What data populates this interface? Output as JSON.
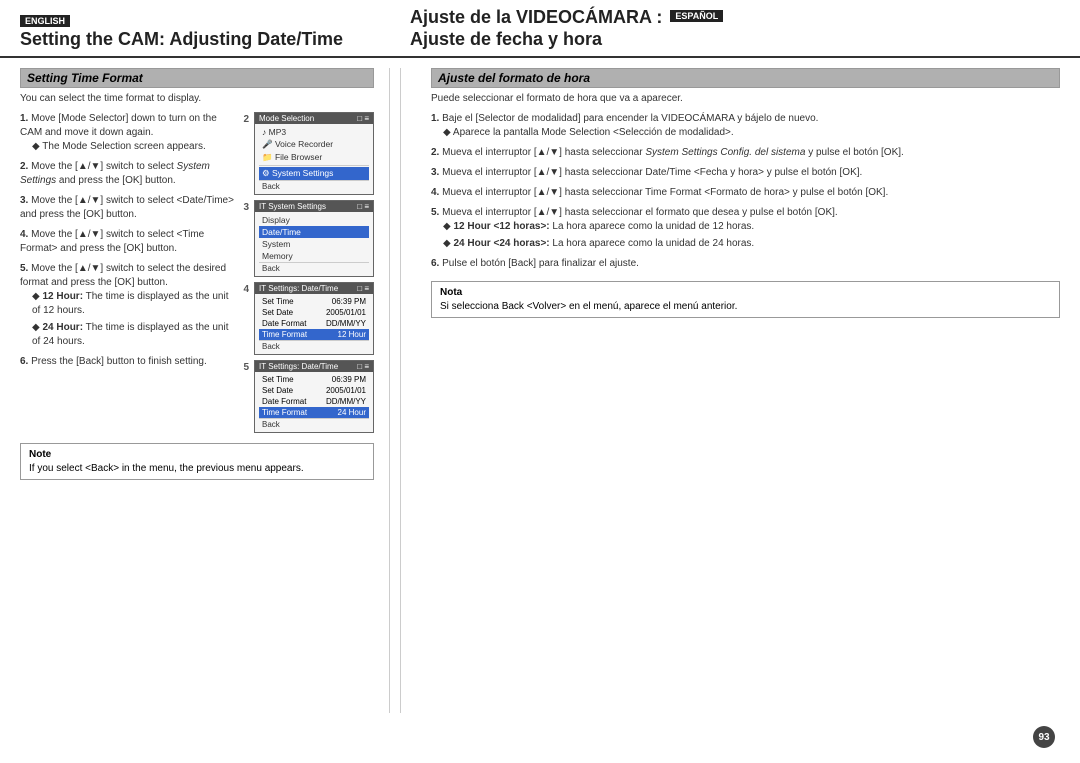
{
  "header": {
    "english_badge": "ENGLISH",
    "espanol_badge": "ESPAÑOL",
    "title_left_line1": "Setting the CAM: Adjusting Date/Time",
    "title_right_line1": "Ajuste de la VIDEOCÁMARA :",
    "title_right_line2": "Ajuste de fecha y hora"
  },
  "left": {
    "section_header": "Setting Time Format",
    "intro": "You can select the time format to display.",
    "steps": [
      {
        "num": "1.",
        "text": "Move [Mode Selector] down to turn on the CAM and move it down again.",
        "bullet": "The Mode Selection screen appears."
      },
      {
        "num": "2.",
        "text_bold": "Move the [▲/▼] switch to select ",
        "text_italic": "System Settings",
        "text_end": " and press the [OK] button."
      },
      {
        "num": "3.",
        "text": "Move the [▲/▼] switch to select <Date/Time> and press the [OK] button."
      },
      {
        "num": "4.",
        "text": "Move the [▲/▼] switch to select <Time Format> and press the [OK] button."
      },
      {
        "num": "5.",
        "text": "Move the [▲/▼] switch to select the desired format and press the [OK] button.",
        "bullets": [
          "12 Hour: The time is displayed as the unit of 12 hours.",
          "24 Hour: The time is displayed as the unit of 24 hours."
        ]
      },
      {
        "num": "6.",
        "text": "Press the [Back] button to finish setting."
      }
    ],
    "note": {
      "title": "Note",
      "text": "If you select <Back> in the menu, the previous menu appears."
    }
  },
  "right": {
    "section_header": "Ajuste del formato de hora",
    "intro": "Puede seleccionar el formato de hora que va a aparecer.",
    "steps": [
      {
        "num": "1.",
        "text": "Baje el [Selector de modalidad] para encender la VIDEOCÁMARA y bájelo de nuevo.",
        "bullet": "Aparece la pantalla Mode Selection <Selección de modalidad>."
      },
      {
        "num": "2.",
        "text": "Mueva el interruptor [▲/▼] hasta seleccionar ",
        "text_italic": "System Settings  Config. del sistema",
        "text_end": " y pulse el botón [OK]."
      },
      {
        "num": "3.",
        "text": "Mueva el interruptor [▲/▼] hasta seleccionar Date/Time <Fecha y hora> y pulse el botón [OK]."
      },
      {
        "num": "4.",
        "text": "Mueva el interruptor [▲/▼] hasta seleccionar Time Format <Formato de hora> y pulse el botón [OK]."
      },
      {
        "num": "5.",
        "text": "Mueva el interruptor [▲/▼] hasta seleccionar el formato que desea y pulse el botón [OK].",
        "bullets": [
          "12 Hour <12 horas>: La hora aparece como la unidad de 12 horas.",
          "24 Hour <24 horas>: La hora aparece como la unidad de 24 horas."
        ]
      },
      {
        "num": "6.",
        "text": "Pulse el botón [Back] para finalizar el ajuste."
      }
    ],
    "note": {
      "title": "Nota",
      "text": "Si selecciona Back <Volver> en el menú, aparece el menú anterior."
    }
  },
  "panels": {
    "panel2": {
      "header": "Mode Selection",
      "items": [
        "MP3",
        "Voice Recorder",
        "File Browser",
        "System Settings"
      ],
      "selected": "System Settings",
      "back": "Back"
    },
    "panel3": {
      "header": "IT System Settings",
      "items": [
        "Display",
        "Date/Time",
        "System",
        "Memory"
      ],
      "selected": "Date/Time",
      "back": "Back"
    },
    "panel4": {
      "header": "IT Settings: Date/Time",
      "rows": [
        {
          "label": "Set Time",
          "value": "06:39 PM"
        },
        {
          "label": "Set Date",
          "value": "2005/01/01"
        },
        {
          "label": "Date Format",
          "value": "DD/MM/YY"
        },
        {
          "label": "Time Format",
          "value": "12 Hour"
        }
      ],
      "selected": "Time Format",
      "back": "Back"
    },
    "panel5": {
      "header": "IT Settings: Date/Time",
      "rows": [
        {
          "label": "Set Time",
          "value": "06:39 PM"
        },
        {
          "label": "Set Date",
          "value": "2005/01/01"
        },
        {
          "label": "Date Format",
          "value": "DD/MM/YY"
        },
        {
          "label": "Time Format",
          "value": "24 Hour"
        }
      ],
      "selected": "Time Format",
      "back": "Back"
    }
  },
  "page_number": "93"
}
